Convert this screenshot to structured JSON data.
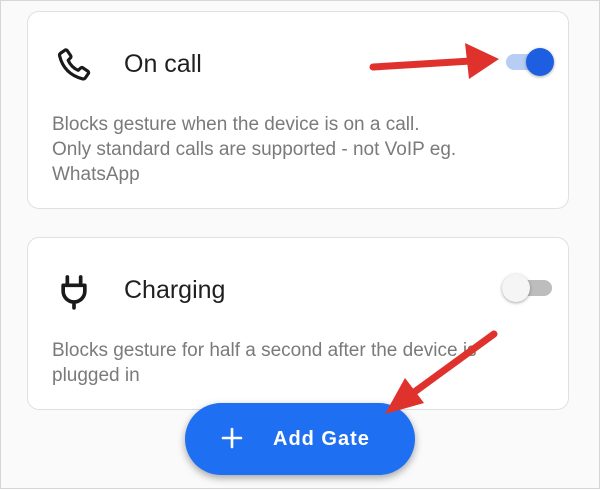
{
  "gates": [
    {
      "title": "On call",
      "description": "Blocks gesture when the device is on a call.\nOnly standard calls are supported - not VoIP eg.\nWhatsApp",
      "icon": "phone-icon",
      "enabled": true
    },
    {
      "title": "Charging",
      "description": "Blocks gesture for half a second after the device is\nplugged in",
      "icon": "plug-icon",
      "enabled": false
    }
  ],
  "fab": {
    "label": "Add Gate",
    "icon": "plus-icon"
  },
  "colors": {
    "accent": "#1f6ff2",
    "toggle_on": "#1e5fe1",
    "annotation_arrow": "#e0322d"
  }
}
